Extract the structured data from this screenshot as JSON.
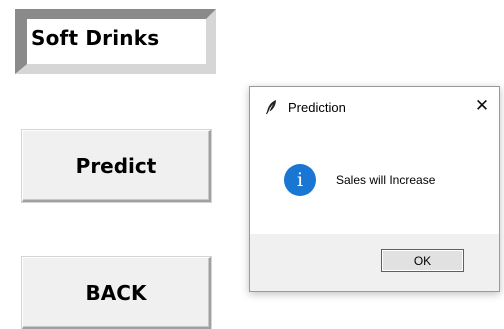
{
  "window": {
    "category_label": "Soft Drinks",
    "predict_button_label": "Predict",
    "back_button_label": "BACK"
  },
  "dialog": {
    "title": "Prediction",
    "title_icon": "feather-icon",
    "close_label": "✕",
    "message_icon": "info-icon",
    "message_icon_glyph": "i",
    "message": "Sales will Increase",
    "ok_label": "OK"
  },
  "colors": {
    "info_icon": "#1976d2",
    "ok_border": "#0078d7",
    "footer_bg": "#f0f0f0"
  }
}
